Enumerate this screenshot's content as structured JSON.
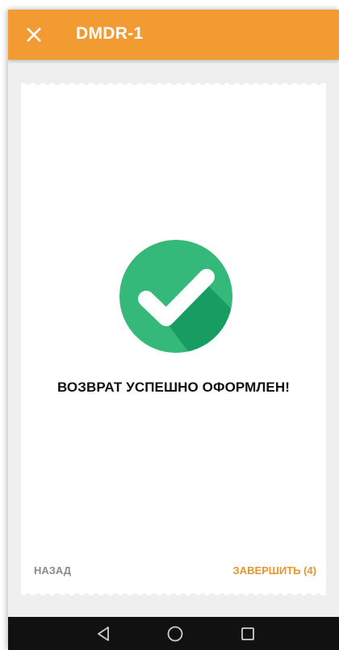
{
  "appbar": {
    "title": "DMDR-1",
    "close_icon": "close-icon",
    "background_color": "#f39b33"
  },
  "main": {
    "status_icon": "check-circle-icon",
    "status_icon_color": "#35b97a",
    "message": "ВОЗВРАТ УСПЕШНО ОФОРМЛЕН!"
  },
  "footer": {
    "back_label": "НАЗАД",
    "finish_label": "ЗАВЕРШИТЬ (4)",
    "finish_color": "#e8962c"
  },
  "system_nav": {
    "back_icon": "nav-back-icon",
    "home_icon": "nav-home-icon",
    "recents_icon": "nav-recents-icon"
  }
}
